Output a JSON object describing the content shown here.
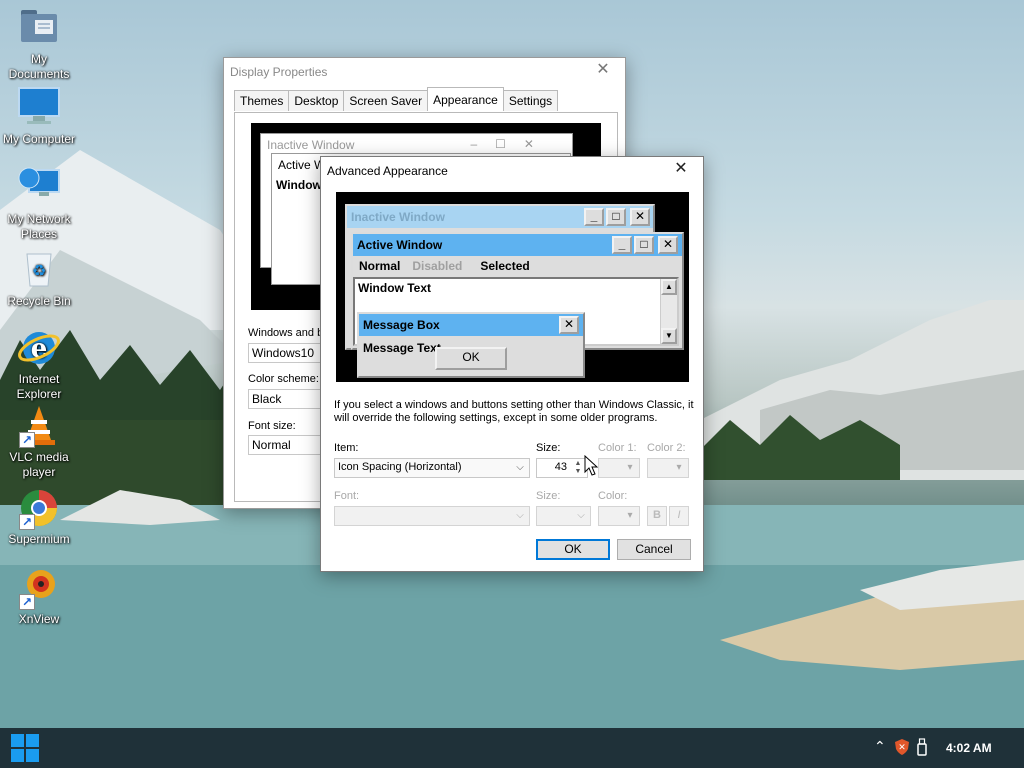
{
  "desktop_icons": [
    {
      "label": "My Documents",
      "icon": "folder-documents-icon"
    },
    {
      "label": "My Computer",
      "icon": "computer-monitor-icon"
    },
    {
      "label": "My Network Places",
      "icon": "network-globe-icon"
    },
    {
      "label": "Recycle Bin",
      "icon": "recycle-bin-icon"
    },
    {
      "label": "Internet Explorer",
      "icon": "internet-explorer-icon"
    },
    {
      "label": "VLC media player",
      "icon": "vlc-cone-icon"
    },
    {
      "label": "Supermium",
      "icon": "supermium-browser-icon"
    },
    {
      "label": "XnView",
      "icon": "xnview-icon"
    }
  ],
  "display_properties": {
    "title": "Display Properties",
    "tabs": [
      "Themes",
      "Desktop",
      "Screen Saver",
      "Appearance",
      "Settings"
    ],
    "active_tab": "Appearance",
    "preview": {
      "inactive_title": "Inactive Window",
      "active_title": "Active W",
      "window_text": "Window"
    },
    "windows_buttons_label": "Windows and b",
    "windows_buttons_value": "Windows10",
    "color_scheme_label": "Color scheme:",
    "color_scheme_value": "Black",
    "font_size_label": "Font size:",
    "font_size_value": "Normal"
  },
  "advanced_appearance": {
    "title": "Advanced Appearance",
    "preview": {
      "inactive_title": "Inactive Window",
      "active_title": "Active Window",
      "menu": [
        "Normal",
        "Disabled",
        "Selected"
      ],
      "window_text": "Window Text",
      "message_box_title": "Message Box",
      "message_text": "Message Text",
      "ok_label": "OK"
    },
    "info_text": "If you select a windows and buttons setting other than Windows Classic, it will override the following settings, except in some older programs.",
    "item_label": "Item:",
    "item_value": "Icon Spacing (Horizontal)",
    "size_label": "Size:",
    "size_value": "43",
    "color1_label": "Color 1:",
    "color2_label": "Color 2:",
    "font_label": "Font:",
    "font_size_label": "Size:",
    "font_color_label": "Color:",
    "bold_label": "B",
    "italic_label": "I",
    "ok_label": "OK",
    "cancel_label": "Cancel"
  },
  "taskbar": {
    "time": "4:02 AM",
    "tray_icons": [
      "chevron-up-icon",
      "shield-security-icon",
      "usb-drive-icon"
    ]
  },
  "colors": {
    "titlebar_active": "#5eb2f0",
    "titlebar_inactive": "#a8d4f2",
    "selected_item": "#5eb2f0",
    "taskbar": "#1f3139",
    "accent": "#0078d7"
  }
}
